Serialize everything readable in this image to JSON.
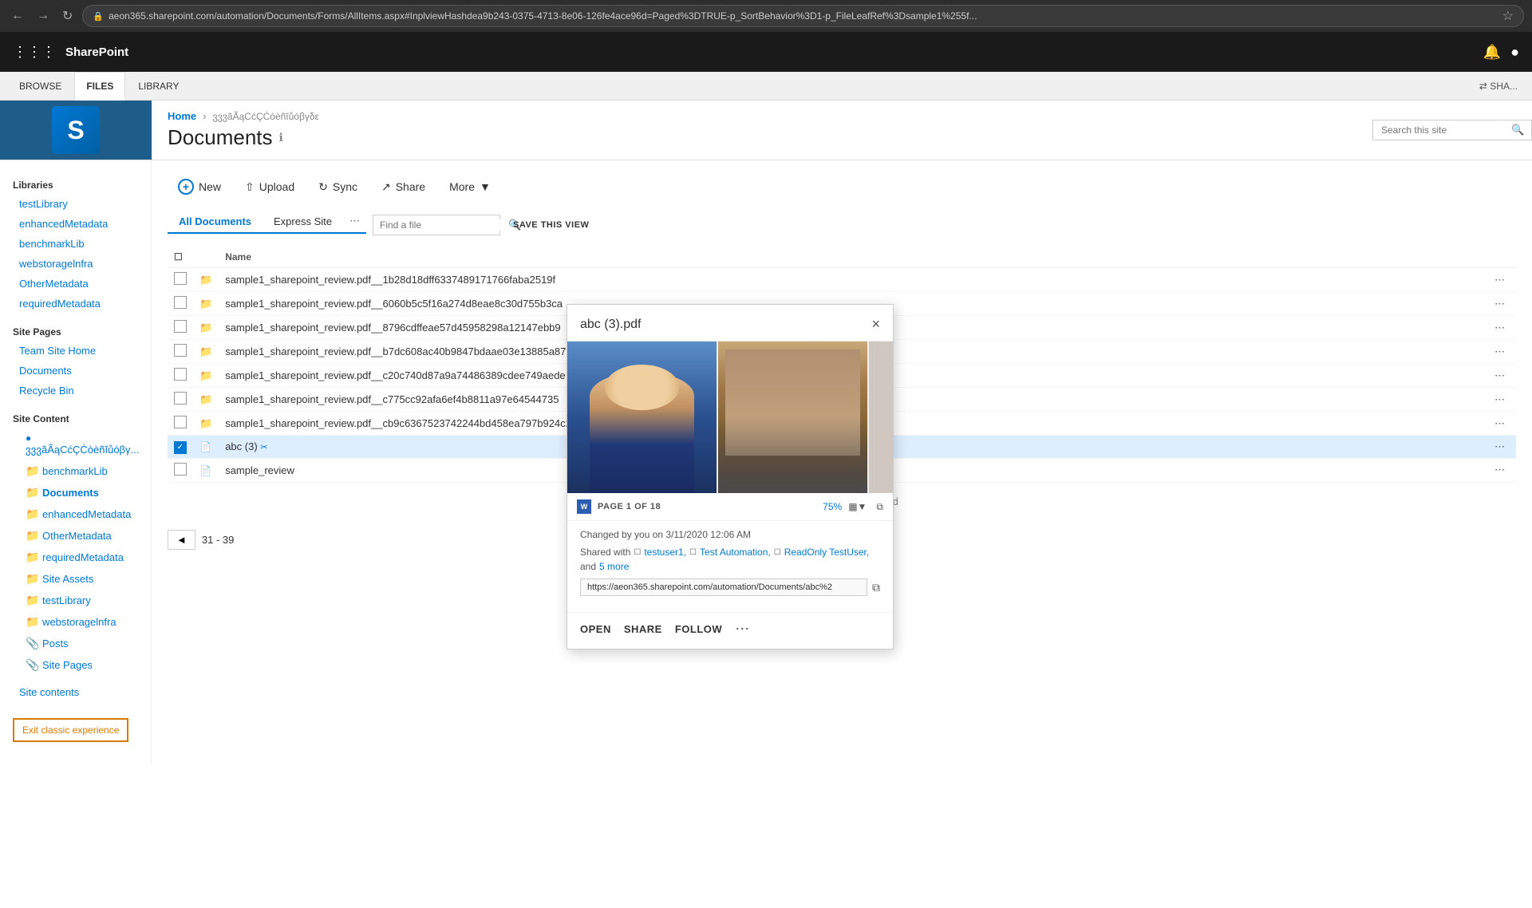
{
  "browser": {
    "address": "aeon365.sharepoint.com/automation/Documents/Forms/AllItems.aspx#InplviewHashdea9b243-0375-4713-8e06-126fe4ace96d=Paged%3DTRUE-p_SortBehavior%3D1-p_FileLeafRef%3Dsample1%255f...",
    "title": "SharePoint"
  },
  "ribbon": {
    "tabs": [
      "BROWSE",
      "FILES",
      "LIBRARY"
    ],
    "active_tab": "FILES",
    "share_label": "SHA..."
  },
  "site": {
    "name": "SharePoint",
    "logo_letter": "S"
  },
  "header": {
    "breadcrumb_home": "Home",
    "breadcrumb_sub": "ვვვãÃąCćÇĊòèñĭůóβγδε",
    "title": "Documents",
    "info_icon": "ℹ",
    "search_placeholder": "Search this site"
  },
  "sidebar": {
    "libraries_label": "Libraries",
    "libraries": [
      "testLibrary",
      "enhancedMetadata",
      "benchmarkLib",
      "webstoragelnfra",
      "OtherMetadata",
      "requiredMetadata"
    ],
    "site_pages_label": "Site Pages",
    "team_site_home": "Team Site Home",
    "documents": "Documents",
    "recycle_bin": "Recycle Bin",
    "site_content_label": "Site Content",
    "site_content_items": [
      "ვვვãÃąCćÇĊòèñĭůóβγ...",
      "benchmarkLib",
      "Documents",
      "enhancedMetadata",
      "OtherMetadata",
      "requiredMetadata",
      "Site Assets",
      "testLibrary",
      "webstoragelnfra",
      "Posts",
      "Site Pages"
    ],
    "site_contents_link": "Site contents",
    "exit_classic": "Exit classic experience"
  },
  "toolbar": {
    "new_label": "New",
    "upload_label": "Upload",
    "sync_label": "Sync",
    "share_label": "Share",
    "more_label": "More"
  },
  "view_tabs": {
    "all_documents": "All Documents",
    "express_site": "Express Site",
    "ellipsis": "...",
    "find_file_placeholder": "Find a file",
    "save_view": "SAVE THIS VIEW"
  },
  "columns": {
    "name": "Name"
  },
  "files": [
    {
      "name": "sample1_sharepoint_review.pdf__1b28d18dff6337489171766faba2519f",
      "type": "folder",
      "selected": false
    },
    {
      "name": "sample1_sharepoint_review.pdf__6060b5c5f16a274d8eae8c30d755b3ca",
      "type": "folder",
      "selected": false
    },
    {
      "name": "sample1_sharepoint_review.pdf__8796cdffeae57d45958298a12147ebb9",
      "type": "folder",
      "selected": false
    },
    {
      "name": "sample1_sharepoint_review.pdf__b7dc608ac40b9847bdaae03e13885a87",
      "type": "folder",
      "selected": false
    },
    {
      "name": "sample1_sharepoint_review.pdf__c20c740d87a9a74486389cdee749aede",
      "type": "folder",
      "selected": false
    },
    {
      "name": "sample1_sharepoint_review.pdf__c775cc92afa6ef4b8811a97e64544735",
      "type": "folder",
      "selected": false
    },
    {
      "name": "sample1_sharepoint_review.pdf__cb9c6367523742244bd458ea797b924c2",
      "type": "folder",
      "selected": false
    },
    {
      "name": "abc (3)",
      "type": "pdf",
      "selected": true
    },
    {
      "name": "sample_review",
      "type": "pdf",
      "selected": false
    }
  ],
  "drag_hint": "Drag files here to upload",
  "pagination": {
    "prev_label": "◄",
    "range": "31 - 39"
  },
  "popup": {
    "title": "abc (3).pdf",
    "page_info": "PAGE 1 OF 18",
    "zoom": "75%",
    "changed_by": "Changed by you on 3/11/2020 12:06 AM",
    "shared_with": "Shared with",
    "shared_users": [
      "testuser1,",
      "Test Automation,",
      "ReadOnly TestUser,"
    ],
    "shared_more": "and 5 more",
    "url": "https://aeon365.sharepoint.com/automation/Documents/abc%2",
    "actions": {
      "open": "OPEN",
      "share": "SHARE",
      "follow": "FOLLOW"
    }
  }
}
